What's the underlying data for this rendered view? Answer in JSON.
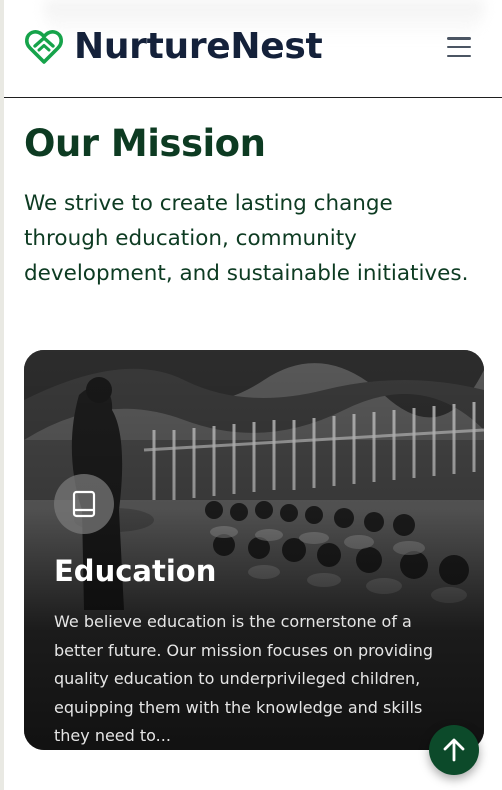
{
  "brand": {
    "name": "NurtureNest",
    "accent": "#16a34a",
    "heading_color": "#0d3b22"
  },
  "nav": {
    "menu_icon": "hamburger-menu-icon"
  },
  "mission": {
    "title": "Our Mission",
    "text": "We strive to create lasting change through education, community development, and sustainable initiatives."
  },
  "cards": [
    {
      "icon": "book-icon",
      "title": "Education",
      "description": "We believe education is the cornerstone of a better future. Our mission focuses on providing quality education to underprivileged children, equipping them with the knowledge and skills they need to..."
    }
  ],
  "scroll_top": {
    "icon": "arrow-up-icon",
    "color": "#0c4a2a"
  }
}
